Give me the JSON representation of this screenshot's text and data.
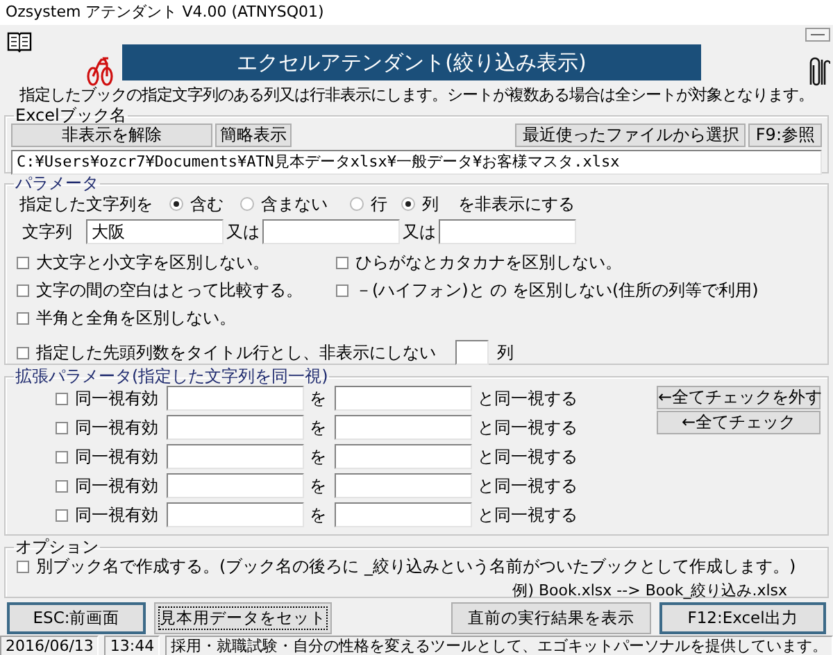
{
  "window": {
    "title": "Ozsystem アテンダント V4.00 (ATNYSQ01)"
  },
  "banner": "エクセルアテンダント(絞り込み表示)",
  "description": "指定したブックの指定文字列のある列又は行非表示にします。シートが複数ある場合は全シートが対象となります。",
  "excel_book": {
    "legend": "Excelブック名",
    "buttons": [
      {
        "label": "非表示を解除",
        "kind": "wide"
      },
      {
        "label": "簡略表示",
        "kind": "small"
      },
      {
        "label": "最近使ったファイルから選択",
        "kind": "right"
      },
      {
        "label": "F9:参照",
        "kind": "right"
      }
    ],
    "path": "C:¥Users¥ozcr7¥Documents¥ATN見本データxlsx¥一般データ¥お客様マスタ.xlsx"
  },
  "parameters": {
    "legend": "パラメータ",
    "mode_label": "指定した文字列を",
    "match_options": [
      {
        "label": "含む",
        "selected": true
      },
      {
        "label": "含まない",
        "selected": false
      }
    ],
    "target_options": [
      {
        "label": "行",
        "selected": false
      },
      {
        "label": "列",
        "selected": true
      }
    ],
    "mode_suffix": "を非表示にする",
    "string_label": "文字列",
    "strings": [
      {
        "value": "大阪"
      },
      {
        "prefix": "又は"
      },
      {
        "prefix": "又は"
      }
    ],
    "checkboxes": [
      {
        "label": "大文字と小文字を区別しない。",
        "checked": false
      },
      {
        "label": "ひらがなとカタカナを区別しない。",
        "checked": false
      },
      {
        "label": "文字の間の空白はとって比較する。",
        "checked": false
      },
      {
        "label": "－(ハイフォン)と の を区別しない(住所の列等で利用)",
        "checked": false
      },
      {
        "label": "半角と全角を区別しない。",
        "checked": false
      }
    ],
    "title_columns": {
      "label": "指定した先頭列数をタイトル行とし、非表示にしない",
      "checked": false,
      "unit": "列"
    }
  },
  "extended": {
    "legend": "拡張パラメータ(指定した文字列を同一視)",
    "rows": [
      {
        "label": "同一視有効",
        "checked": false,
        "joiner": "を",
        "suffix": "と同一視する"
      },
      {
        "label": "同一視有効",
        "checked": false,
        "joiner": "を",
        "suffix": "と同一視する"
      },
      {
        "label": "同一視有効",
        "checked": false,
        "joiner": "を",
        "suffix": "と同一視する"
      },
      {
        "label": "同一視有効",
        "checked": false,
        "joiner": "を",
        "suffix": "と同一視する"
      },
      {
        "label": "同一視有効",
        "checked": false,
        "joiner": "を",
        "suffix": "と同一視する"
      }
    ],
    "buttons": [
      "←全てチェックを外す",
      "←全てチェック"
    ]
  },
  "options": {
    "legend": "オプション",
    "checkbox": {
      "label": "別ブック名で作成する。(ブック名の後ろに _絞り込みという名前がついたブックとして作成します。)",
      "checked": false
    },
    "example": "例) Book.xlsx --> Book_絞り込み.xlsx"
  },
  "actions": [
    {
      "label": "ESC:前画面",
      "emphasized": true,
      "focused": false
    },
    {
      "label": "見本用データをセット",
      "emphasized": false,
      "focused": true
    },
    {
      "label": "直前の実行結果を表示",
      "emphasized": false,
      "focused": false
    },
    {
      "label": "F12:Excel出力",
      "emphasized": true,
      "focused": false
    }
  ],
  "status_bar": [
    "2016/06/13",
    "13:44",
    "採用・就職試験・自分の性格を変えるツールとして、エゴキットパーソナルを提供しています。"
  ]
}
